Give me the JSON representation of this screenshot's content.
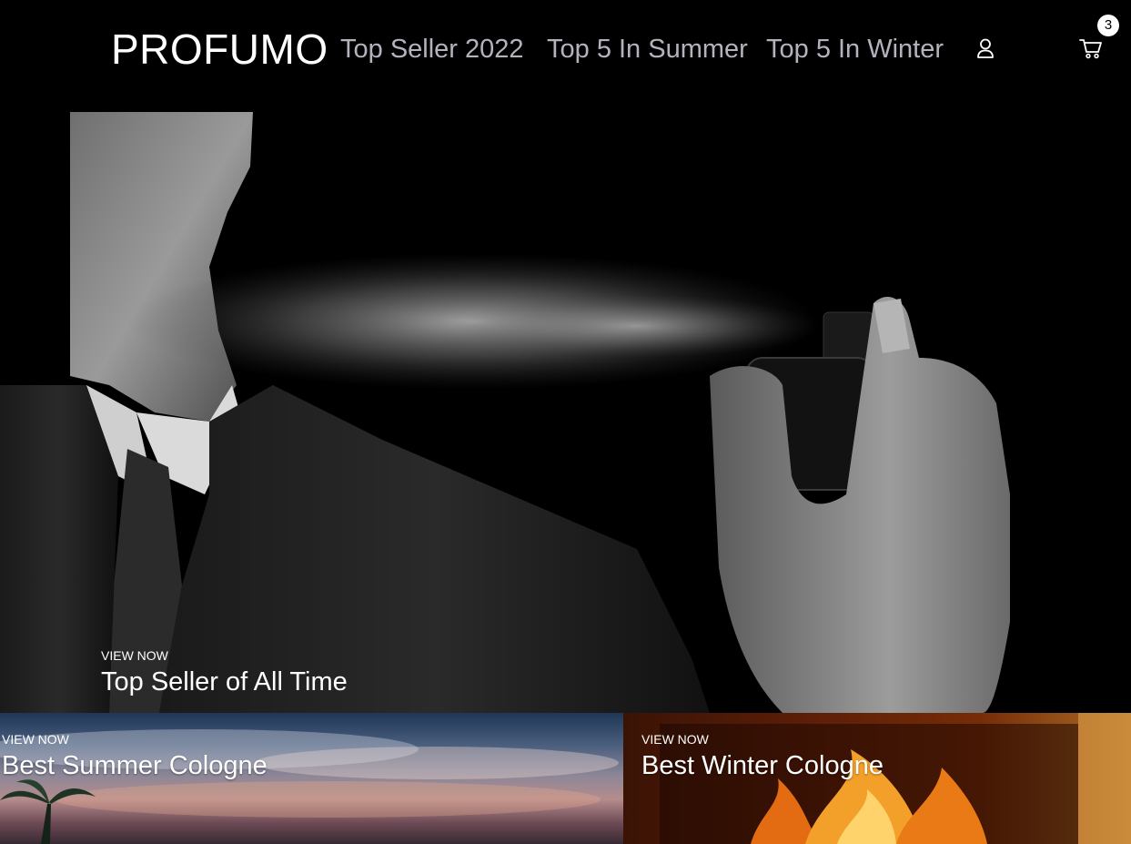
{
  "header": {
    "brand": "PROFUMO",
    "nav": [
      {
        "label": "Top Seller 2022"
      },
      {
        "label": "Top 5 In Summer"
      },
      {
        "label": "Top 5 In Winter"
      }
    ],
    "account_icon": "user-icon",
    "cart_icon": "cart-icon",
    "cart_count": "3"
  },
  "hero": {
    "kicker": "VIEW NOW",
    "title": "Top Seller of All Time",
    "image": "man-spraying-cologne-photo"
  },
  "tiles": [
    {
      "kicker": "VIEW NOW",
      "title": "Best Summer Cologne",
      "image": "summer-sky-palm-photo"
    },
    {
      "kicker": "VIEW NOW",
      "title": "Best Winter Cologne",
      "image": "fireplace-flames-photo"
    }
  ],
  "colors": {
    "background": "#000000",
    "nav_link": "#b3b3bd",
    "text": "#ffffff"
  }
}
